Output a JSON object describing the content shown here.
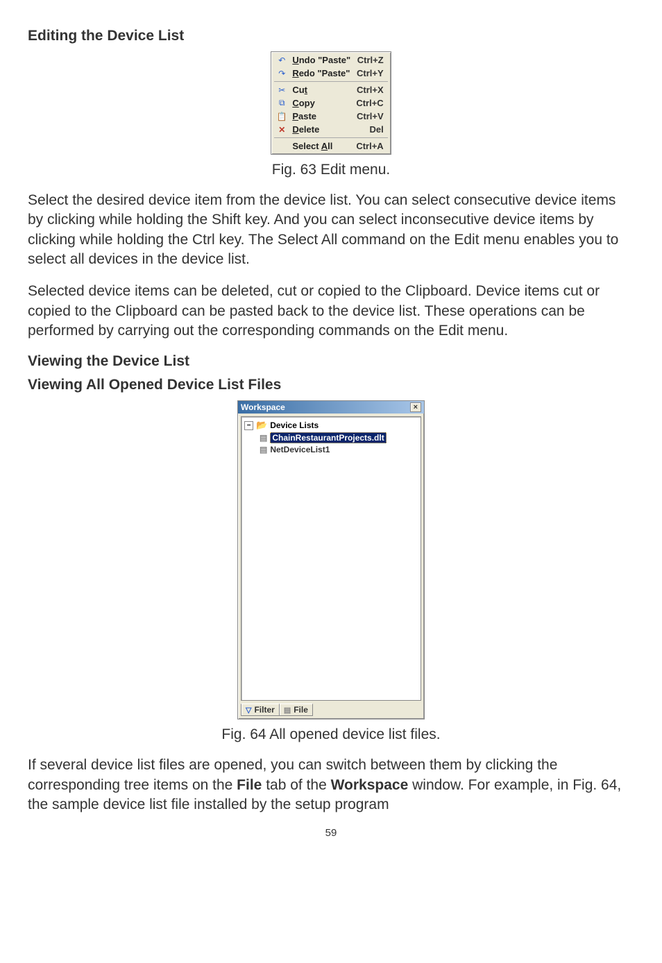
{
  "headings": {
    "h1": "Editing the Device List",
    "h2a": "Viewing the Device List",
    "h2b": "Viewing All Opened Device List Files"
  },
  "fig63": {
    "caption": "Fig. 63 Edit menu.",
    "menu": {
      "undo_label": "Undo \"Paste\"",
      "undo_shortcut": "Ctrl+Z",
      "redo_label": "Redo \"Paste\"",
      "redo_shortcut": "Ctrl+Y",
      "cut_label": "Cut",
      "cut_shortcut": "Ctrl+X",
      "copy_label": "Copy",
      "copy_shortcut": "Ctrl+C",
      "paste_label": "Paste",
      "paste_shortcut": "Ctrl+V",
      "delete_label": "Delete",
      "delete_shortcut": "Del",
      "selectall_label": "Select All",
      "selectall_shortcut": "Ctrl+A"
    }
  },
  "para1": "Select the desired device item from the device list. You can select consecutive device items by clicking while holding the Shift key. And you can select inconsecutive device items by clicking while holding the Ctrl key. The Select All command on the Edit menu enables you to select all devices in the device list.",
  "para2": "Selected device items can be deleted, cut or copied to the Clipboard. Device items cut or copied to the Clipboard can be pasted back to the device list. These operations can be performed by carrying out the corresponding commands on the Edit menu.",
  "fig64": {
    "caption": "Fig. 64 All opened device list files.",
    "title": "Workspace",
    "tree_root": "Device Lists",
    "tree_item_selected": "ChainRestaurantProjects.dlt",
    "tree_item2": "NetDeviceList1",
    "tab_filter": "Filter",
    "tab_file": "File"
  },
  "para3_pre": "If several device list files are opened, you can switch between them by clicking the corresponding tree items on the ",
  "para3_bold1": "File",
  "para3_mid": " tab of the ",
  "para3_bold2": "Workspace",
  "para3_post": " window. For example, in Fig. 64, the sample device list file installed by the setup program",
  "page_number": "59"
}
